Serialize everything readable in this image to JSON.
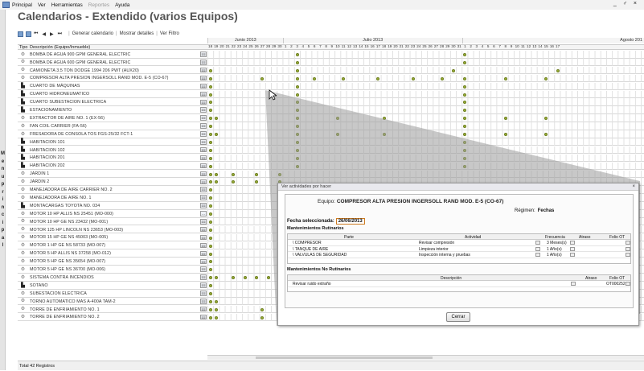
{
  "menubar": {
    "items": [
      {
        "label": "Principal",
        "disabled": false
      },
      {
        "label": "Ver",
        "disabled": false
      },
      {
        "label": "Herramientas",
        "disabled": false
      },
      {
        "label": "Reportes",
        "disabled": true
      },
      {
        "label": "Ayuda",
        "disabled": false
      }
    ],
    "window_controls": "_ ♂ ×"
  },
  "side_tab": "Menu principal",
  "title": "Calendarios - Extendido  (varios Equipos)",
  "toolbar": {
    "generate_label": "Generar calendario",
    "details_label": "Mostrar detalles",
    "filter_label": "Ver Filtro"
  },
  "months": [
    "Junio 2013",
    "Julio 2013",
    "Agosto 201"
  ],
  "columns": {
    "tipo": "Tipo",
    "descripcion": "Descripción (Equipo/Inmueble)"
  },
  "days": [
    "18",
    "19",
    "20",
    "21",
    "22",
    "23",
    "24",
    "25",
    "26",
    "27",
    "28",
    "29",
    "30",
    "1",
    "2",
    "3",
    "4",
    "5",
    "6",
    "7",
    "8",
    "9",
    "10",
    "11",
    "12",
    "13",
    "14",
    "15",
    "16",
    "17",
    "18",
    "19",
    "20",
    "21",
    "22",
    "23",
    "24",
    "25",
    "26",
    "27",
    "28",
    "29",
    "30",
    "31",
    "1",
    "2",
    "3",
    "4",
    "5",
    "6",
    "7",
    "8",
    "9",
    "10",
    "11",
    "12",
    "13",
    "14",
    "15",
    "16",
    "17"
  ],
  "rows": [
    {
      "type": "equip",
      "desc": "BOMBA DE AGUA 900 GPM GENERAL ELECTRIC",
      "btn": "≡≡",
      "dots": [
        15,
        44
      ]
    },
    {
      "type": "equip",
      "desc": "BOMBA DE AGUA 600 GPM GENERAL ELECTRIC",
      "btn": "≡≡",
      "dots": [
        15,
        44
      ]
    },
    {
      "type": "equip",
      "desc": "CAMIONETA 3.5 TON DODGE 1994 206 PWT (AUX20)",
      "btn": "≡≡",
      "dots": [
        0,
        15,
        42,
        60
      ]
    },
    {
      "type": "equip",
      "desc": "COMPRESOR ALTA PRESION INGERSOLL RAND MOD. E-5 (CO-67)",
      "btn": "≡≡",
      "dots": [
        0,
        9,
        15,
        18,
        23,
        29,
        35,
        40,
        44,
        51,
        58
      ]
    },
    {
      "type": "room",
      "desc": "CUARTO DE MÁQUINAS",
      "btn": "≡≡",
      "dots": [
        0,
        15,
        44
      ]
    },
    {
      "type": "room",
      "desc": "CUARTO HIDRONEUMATICO",
      "btn": "≡≡",
      "dots": [
        0,
        15,
        44
      ]
    },
    {
      "type": "room",
      "desc": "CUARTO SUBESTACION ELECTRICA",
      "btn": "≡≡",
      "dots": [
        0,
        15,
        44
      ]
    },
    {
      "type": "room",
      "desc": "ESTACIONAMIENTO",
      "btn": "≡≡",
      "dots": [
        0,
        15,
        44
      ]
    },
    {
      "type": "equip",
      "desc": "EXTRACTOR DE AIRE NO. 1 (EX-56)",
      "btn": "≡≡",
      "dots": [
        0,
        1,
        15,
        22,
        30,
        44,
        51,
        58
      ]
    },
    {
      "type": "equip",
      "desc": "FAN COIL CARRIER (FA-56)",
      "btn": "≡≡",
      "dots": [
        0,
        15,
        44
      ]
    },
    {
      "type": "equip",
      "desc": "FRESADORA DE CONSOLA TOS FGS-25/32 FCT-1",
      "btn": "≡≡",
      "dots": [
        0,
        1,
        15,
        22,
        30,
        44,
        51,
        58
      ]
    },
    {
      "type": "room",
      "desc": "HABITACION 101",
      "btn": "≡≡",
      "dots": [
        0,
        15,
        44
      ]
    },
    {
      "type": "room",
      "desc": "HABITACION 102",
      "btn": "≡≡",
      "dots": [
        0,
        15,
        44
      ]
    },
    {
      "type": "room",
      "desc": "HABITACION 201",
      "btn": "≡≡",
      "dots": [
        0,
        15,
        44
      ]
    },
    {
      "type": "room",
      "desc": "HABITACION 202",
      "btn": "≡≡",
      "dots": [
        0,
        15,
        44
      ]
    },
    {
      "type": "equip",
      "desc": "JARDIN 1",
      "btn": "≡≡",
      "dots": [
        0,
        1,
        4,
        8,
        12
      ]
    },
    {
      "type": "equip",
      "desc": "JARDIN 2",
      "btn": "≡≡",
      "dots": [
        0,
        1,
        4,
        8,
        12
      ]
    },
    {
      "type": "equip",
      "desc": "MANEJADORA DE AIRE CARRIER NO. 2",
      "btn": "≡≡",
      "dots": [
        0,
        15
      ]
    },
    {
      "type": "equip",
      "desc": "MANEJADORA DE AIRE NO. 1",
      "btn": "≡≡",
      "dots": [
        0,
        15
      ]
    },
    {
      "type": "room",
      "desc": "MONTACARGAS TOYOTA NO. 034",
      "btn": "≡≡",
      "dots": [
        0,
        15
      ]
    },
    {
      "type": "equip",
      "desc": "MOTOR 10 HP ALLIS NS 25451 (MO-000)",
      "btn": "...",
      "dots": [
        0
      ]
    },
    {
      "type": "equip",
      "desc": "MOTOR 10 HP GE NS 23432 (MO-001)",
      "btn": "≡≡",
      "dots": [
        0
      ]
    },
    {
      "type": "equip",
      "desc": "MOTOR 125 HP LINCOLN NS 23653 (MO-003)",
      "btn": "≡≡",
      "dots": [
        0
      ]
    },
    {
      "type": "equip",
      "desc": "MOTOR 15 HP GE NS 45003 (MO-005)",
      "btn": "≡≡",
      "dots": [
        0
      ]
    },
    {
      "type": "equip",
      "desc": "MOTOR 1 HP GE NS 58733 (MO-007)",
      "btn": "≡≡",
      "dots": [
        0
      ]
    },
    {
      "type": "equip",
      "desc": "MOTOR 5 HP ALLIS NS 37258 (MO-012)",
      "btn": "≡≡",
      "dots": [
        0
      ]
    },
    {
      "type": "equip",
      "desc": "MOTOR 5 HP GE NS 35654 (MO-007)",
      "btn": "≡≡",
      "dots": [
        0
      ]
    },
    {
      "type": "equip",
      "desc": "MOTOR 5 HP GE NS 36700 (MO-006)",
      "btn": "≡≡",
      "dots": [
        0
      ]
    },
    {
      "type": "equip",
      "desc": "SISTEMA CONTRA INCENDIOS",
      "btn": "≡≡",
      "dots": [
        0,
        1,
        4,
        6,
        8,
        10
      ]
    },
    {
      "type": "room",
      "desc": "SOTANO",
      "btn": "≡≡",
      "dots": [
        0
      ]
    },
    {
      "type": "equip",
      "desc": "SUBESTACION ELECTRICA",
      "btn": "≡≡",
      "dots": [
        0
      ]
    },
    {
      "type": "equip",
      "desc": "TORNO AUTOMATICO MAS A-400A TAM-2",
      "btn": "≡≡",
      "dots": [
        0,
        1,
        44,
        45
      ]
    },
    {
      "type": "equip",
      "desc": "TORRE DE ENFRIAMIENTO NO. 1",
      "btn": "≡≡",
      "dots": [
        0,
        1,
        9,
        15,
        22,
        30,
        37,
        44,
        45,
        51,
        58
      ]
    },
    {
      "type": "equip",
      "desc": "TORRE DE ENFRIAMIENTO NO. 2",
      "btn": "≡≡",
      "dots": [
        0,
        1,
        9,
        15,
        22,
        30,
        37,
        44,
        45,
        51,
        58
      ]
    }
  ],
  "status": "Total 42 Registros",
  "dialog": {
    "title": "Ver actividades por hacer",
    "equipo_label": "Equipo:",
    "equipo_value": "COMPRESOR ALTA PRESION INGERSOLL RAND MOD. E-5 (CO-67)",
    "regimen_label": "Régimen:",
    "regimen_value": "Fechas",
    "fecha_label": "Fecha seleccionada:",
    "fecha_value": "26/06/2013",
    "rutinarios_title": "Mantenimientos Rutinarios",
    "rut_headers": {
      "parte": "Parte",
      "actividad": "Actividad",
      "frecuencia": "Frecuencia",
      "atrasos": "Atraso",
      "folio": "Folio OT"
    },
    "rut_rows": [
      {
        "parte": "\\ COMPRESOR",
        "actividad": "Revisar compresión",
        "frecuencia": "3 Meses(s)"
      },
      {
        "parte": "\\ TANQUE DE AIRE",
        "actividad": "Limpieza interior",
        "frecuencia": "1 Año(s)"
      },
      {
        "parte": "\\ VALVULAS DE SEGURIDAD",
        "actividad": "Inspección interna y pruebas",
        "frecuencia": "1 Año(s)"
      }
    ],
    "norut_title": "Mantenimientos No Rutinarios",
    "norut_headers": {
      "descripcion": "Descripción",
      "atraso": "Atraso",
      "folio": "Folio OT"
    },
    "norut_rows": [
      {
        "descripcion": "Revisar ruido extraño",
        "folio": "OT000252"
      }
    ],
    "close_label": "Cerrar"
  }
}
